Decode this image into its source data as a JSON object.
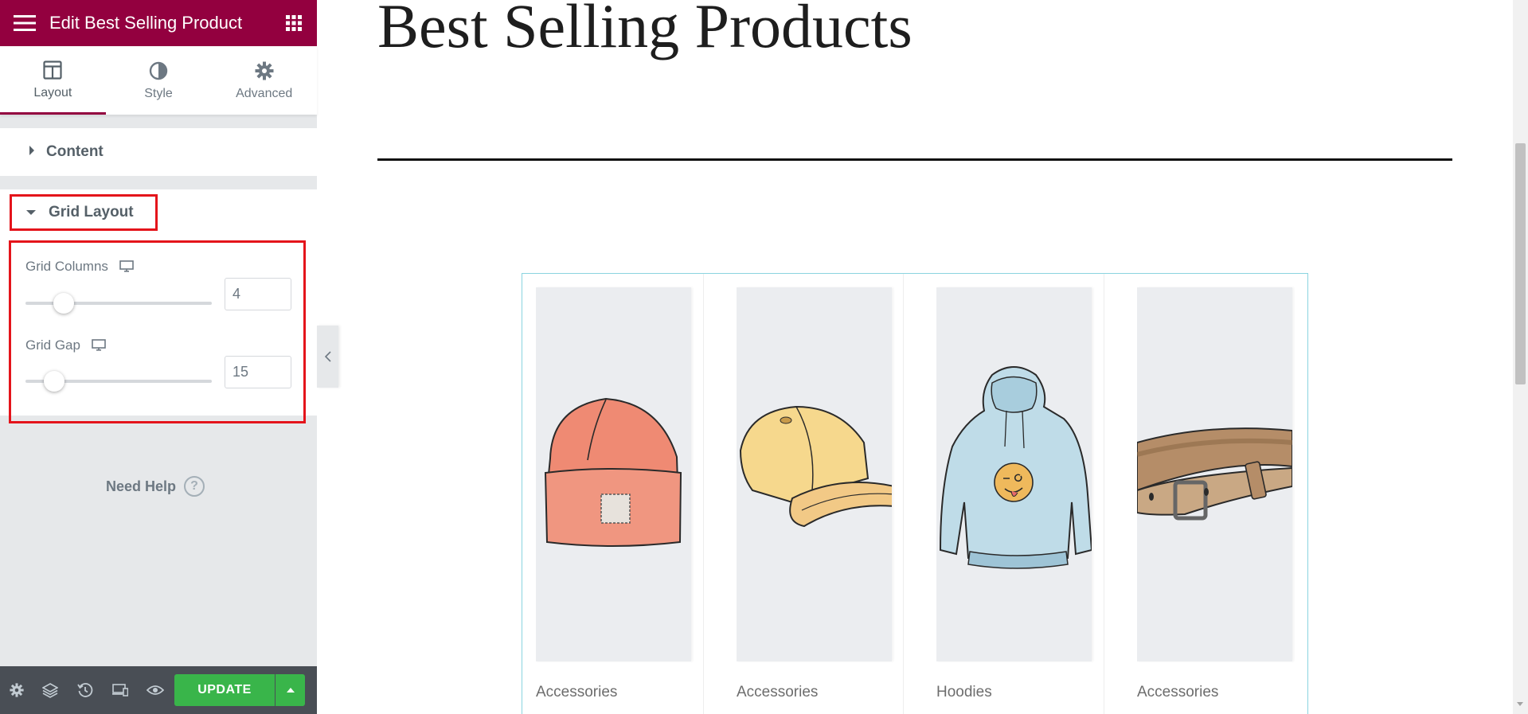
{
  "header": {
    "title": "Edit Best Selling Product",
    "menu_icon": "hamburger-icon",
    "apps_icon": "grid-icon"
  },
  "tabs": [
    {
      "label": "Layout",
      "icon": "layout-icon",
      "active": true
    },
    {
      "label": "Style",
      "icon": "half-circle-icon",
      "active": false
    },
    {
      "label": "Advanced",
      "icon": "gear-icon",
      "active": false
    }
  ],
  "sections": {
    "content": {
      "label": "Content",
      "expanded": false
    },
    "grid_layout": {
      "label": "Grid Layout",
      "expanded": true
    }
  },
  "controls": {
    "grid_columns": {
      "label": "Grid Columns",
      "value": "4",
      "slider_fraction": 0.17
    },
    "grid_gap": {
      "label": "Grid Gap",
      "value": "15",
      "slider_fraction": 0.11
    }
  },
  "help": {
    "label": "Need Help",
    "icon_text": "?"
  },
  "footer": {
    "update_label": "UPDATE",
    "icons": [
      "settings-icon",
      "layers-icon",
      "history-icon",
      "responsive-icon",
      "preview-eye-icon"
    ]
  },
  "preview": {
    "page_title": "Best Selling Products",
    "products": [
      {
        "category": "Accessories",
        "image": "beanie"
      },
      {
        "category": "Accessories",
        "image": "cap"
      },
      {
        "category": "Hoodies",
        "image": "hoodie"
      },
      {
        "category": "Accessories",
        "image": "belt"
      }
    ]
  },
  "colors": {
    "brand": "#93003f",
    "update_green": "#39b54a",
    "highlight_red": "#e4141b",
    "selection_border": "#8ad4e0"
  }
}
